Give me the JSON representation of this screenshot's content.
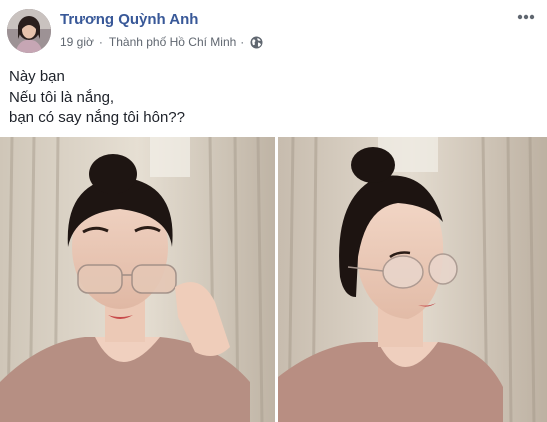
{
  "post": {
    "author": "Trương Quỳnh Anh",
    "time": "19 giờ",
    "location": "Thành phố Hồ Chí Minh",
    "privacy_icon": "globe-icon",
    "menu_icon": "more-options-icon",
    "text_lines": [
      "Này bạn",
      "Nếu tôi là nắng,",
      "bạn có say nắng tôi hôn??"
    ]
  },
  "colors": {
    "author_link": "#385898",
    "meta_text": "#606770",
    "body_text": "#1d2129"
  },
  "photos": [
    {
      "name": "photo-1",
      "description_icon": "selfie-photo"
    },
    {
      "name": "photo-2",
      "description_icon": "profile-photo"
    }
  ]
}
